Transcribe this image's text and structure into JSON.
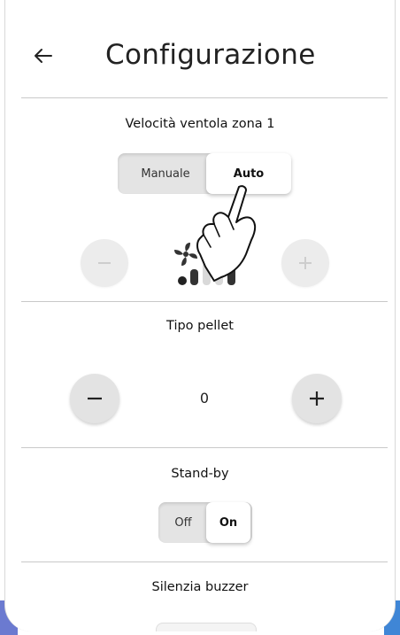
{
  "header": {
    "title": "Configurazione",
    "back_icon": "arrow-left-icon"
  },
  "fan_speed": {
    "label": "Velocità ventola zona 1",
    "modes": [
      "Manuale",
      "Auto"
    ],
    "selected_mode": "Auto",
    "minus_enabled": false,
    "plus_enabled": false,
    "fan_icon": "fan-icon",
    "level_icon": "signal-bars-icon"
  },
  "pellet_type": {
    "label": "Tipo pellet",
    "value": "0"
  },
  "standby": {
    "label": "Stand-by",
    "options": [
      "Off",
      "On"
    ],
    "selected": "On"
  },
  "buzzer": {
    "label": "Silenzia buzzer"
  },
  "overlay": {
    "pointer_icon": "hand-pointer-icon"
  },
  "colors": {
    "disabled_gray": "#c6c6c6",
    "button_bg": "#e3e3e3",
    "active_bg": "#ffffff",
    "corner_left": "#6b7ad0",
    "corner_right": "#3f86d6"
  }
}
